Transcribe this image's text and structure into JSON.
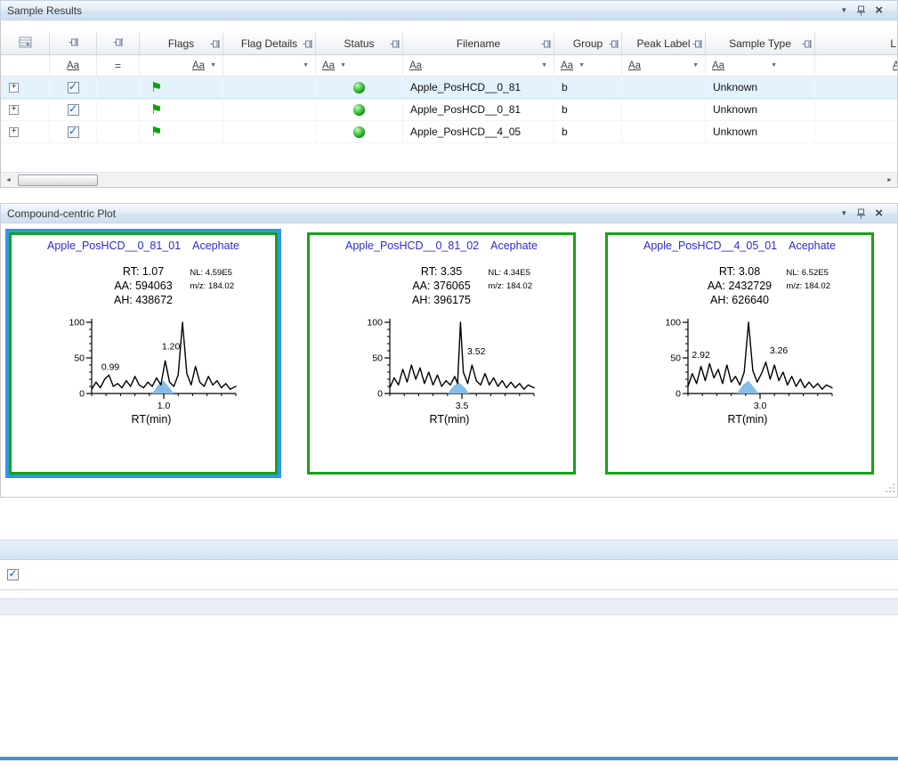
{
  "icons": {
    "dropdown": "▼",
    "close": "×",
    "check": "✓",
    "flag": "⚑",
    "expand": "+",
    "scroll_left": "◄",
    "scroll_right": "►"
  },
  "sample_results": {
    "title": "Sample Results",
    "columns": {
      "flags": "Flags",
      "flag_details": "Flag Details",
      "status": "Status",
      "filename": "Filename",
      "group": "Group",
      "peak_label": "Peak Label",
      "sample_type": "Sample Type",
      "last_partial": "L"
    },
    "filter": {
      "text_op": "Aa",
      "eq_op": "="
    },
    "rows": [
      {
        "selected": true,
        "checked": true,
        "flag": "green",
        "status": "green",
        "filename": "Apple_PosHCD__0_81",
        "group": "b",
        "peak_label": "",
        "sample_type": "Unknown"
      },
      {
        "selected": false,
        "checked": true,
        "flag": "green",
        "status": "green",
        "filename": "Apple_PosHCD__0_81",
        "group": "b",
        "peak_label": "",
        "sample_type": "Unknown"
      },
      {
        "selected": false,
        "checked": true,
        "flag": "green",
        "status": "green",
        "filename": "Apple_PosHCD__4_05",
        "group": "b",
        "peak_label": "",
        "sample_type": "Unknown"
      }
    ]
  },
  "compound_plot": {
    "title": "Compound-centric Plot"
  },
  "lower_panel": {
    "row_checked": true
  },
  "chart_data": [
    {
      "type": "line",
      "title": "Apple_PosHCD__0_81_01",
      "compound": "Acephate",
      "nl": "NL: 4.59E5",
      "mz": "m/z: 184.02",
      "rt": "RT: 1.07",
      "aa": "AA: 594063",
      "ah": "AH: 438672",
      "xlabel": "RT(min)",
      "x_tick_label": "1.0",
      "y_ticks": [
        "0",
        "50",
        "100"
      ],
      "ylim": [
        0,
        100
      ],
      "selected": true,
      "peak_labels": [
        {
          "text": "0.99",
          "x": 13,
          "y": 33
        },
        {
          "text": "1.20",
          "x": 55,
          "y": 62
        }
      ],
      "points": [
        [
          0,
          6
        ],
        [
          3,
          16
        ],
        [
          6,
          8
        ],
        [
          9,
          20
        ],
        [
          12,
          26
        ],
        [
          15,
          10
        ],
        [
          18,
          14
        ],
        [
          21,
          8
        ],
        [
          24,
          18
        ],
        [
          27,
          10
        ],
        [
          30,
          24
        ],
        [
          33,
          12
        ],
        [
          36,
          8
        ],
        [
          39,
          16
        ],
        [
          42,
          10
        ],
        [
          45,
          22
        ],
        [
          48,
          12
        ],
        [
          51,
          46
        ],
        [
          54,
          16
        ],
        [
          57,
          10
        ],
        [
          60,
          26
        ],
        [
          63,
          100
        ],
        [
          66,
          28
        ],
        [
          69,
          12
        ],
        [
          72,
          38
        ],
        [
          75,
          16
        ],
        [
          78,
          10
        ],
        [
          81,
          24
        ],
        [
          84,
          12
        ],
        [
          87,
          18
        ],
        [
          90,
          8
        ],
        [
          93,
          14
        ],
        [
          96,
          6
        ],
        [
          100,
          10
        ]
      ],
      "fill": [
        [
          42,
          0
        ],
        [
          46,
          12
        ],
        [
          50,
          18
        ],
        [
          54,
          8
        ],
        [
          57,
          0
        ]
      ]
    },
    {
      "type": "line",
      "title": "Apple_PosHCD__0_81_02",
      "compound": "Acephate",
      "nl": "NL: 4.34E5",
      "mz": "m/z: 184.02",
      "rt": "RT: 3.35",
      "aa": "AA: 376065",
      "ah": "AH: 396175",
      "xlabel": "RT(min)",
      "x_tick_label": "3.5",
      "y_ticks": [
        "0",
        "50",
        "100"
      ],
      "ylim": [
        0,
        100
      ],
      "selected": false,
      "peak_labels": [
        {
          "text": "3.52",
          "x": 60,
          "y": 55
        }
      ],
      "points": [
        [
          0,
          8
        ],
        [
          3,
          22
        ],
        [
          6,
          12
        ],
        [
          9,
          34
        ],
        [
          12,
          16
        ],
        [
          15,
          40
        ],
        [
          18,
          20
        ],
        [
          21,
          36
        ],
        [
          24,
          14
        ],
        [
          27,
          30
        ],
        [
          30,
          12
        ],
        [
          33,
          26
        ],
        [
          36,
          10
        ],
        [
          39,
          18
        ],
        [
          42,
          12
        ],
        [
          45,
          24
        ],
        [
          47,
          14
        ],
        [
          49,
          100
        ],
        [
          51,
          30
        ],
        [
          54,
          14
        ],
        [
          57,
          40
        ],
        [
          60,
          18
        ],
        [
          63,
          12
        ],
        [
          66,
          28
        ],
        [
          69,
          12
        ],
        [
          72,
          22
        ],
        [
          75,
          10
        ],
        [
          78,
          18
        ],
        [
          81,
          8
        ],
        [
          84,
          16
        ],
        [
          87,
          8
        ],
        [
          90,
          14
        ],
        [
          93,
          6
        ],
        [
          96,
          12
        ],
        [
          100,
          8
        ]
      ],
      "fill": [
        [
          40,
          0
        ],
        [
          44,
          10
        ],
        [
          48,
          16
        ],
        [
          52,
          8
        ],
        [
          55,
          0
        ]
      ]
    },
    {
      "type": "line",
      "title": "Apple_PosHCD__4_05_01",
      "compound": "Acephate",
      "nl": "NL: 6.52E5",
      "mz": "m/z: 184.02",
      "rt": "RT: 3.08",
      "aa": "AA: 2432729",
      "ah": "AH: 626640",
      "xlabel": "RT(min)",
      "x_tick_label": "3.0",
      "y_ticks": [
        "0",
        "50",
        "100"
      ],
      "ylim": [
        0,
        100
      ],
      "selected": false,
      "peak_labels": [
        {
          "text": "2.92",
          "x": 9,
          "y": 50
        },
        {
          "text": "3.26",
          "x": 63,
          "y": 56
        }
      ],
      "points": [
        [
          0,
          10
        ],
        [
          3,
          28
        ],
        [
          6,
          14
        ],
        [
          9,
          38
        ],
        [
          12,
          18
        ],
        [
          15,
          42
        ],
        [
          18,
          22
        ],
        [
          21,
          34
        ],
        [
          24,
          14
        ],
        [
          27,
          40
        ],
        [
          30,
          16
        ],
        [
          33,
          24
        ],
        [
          36,
          12
        ],
        [
          39,
          30
        ],
        [
          42,
          100
        ],
        [
          45,
          32
        ],
        [
          48,
          16
        ],
        [
          51,
          28
        ],
        [
          54,
          44
        ],
        [
          57,
          20
        ],
        [
          60,
          40
        ],
        [
          63,
          18
        ],
        [
          66,
          30
        ],
        [
          69,
          12
        ],
        [
          72,
          24
        ],
        [
          75,
          10
        ],
        [
          78,
          20
        ],
        [
          81,
          8
        ],
        [
          84,
          16
        ],
        [
          87,
          8
        ],
        [
          90,
          14
        ],
        [
          93,
          6
        ],
        [
          96,
          12
        ],
        [
          100,
          8
        ]
      ],
      "fill": [
        [
          34,
          0
        ],
        [
          38,
          12
        ],
        [
          42,
          18
        ],
        [
          46,
          8
        ],
        [
          49,
          0
        ]
      ]
    }
  ]
}
